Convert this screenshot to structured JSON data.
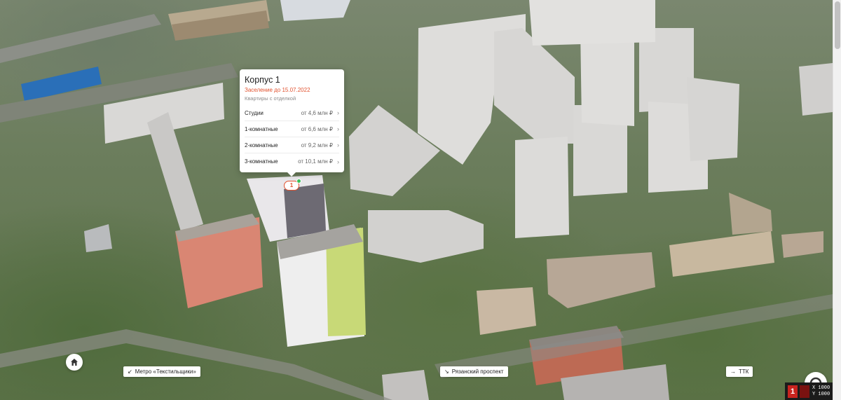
{
  "popup": {
    "title": "Корпус 1",
    "settlement": "Заселение до 15.07.2022",
    "finish": "Квартиры с отделкой",
    "rows": [
      {
        "name": "Студии",
        "price": "от 4,6 млн ₽"
      },
      {
        "name": "1-комнатные",
        "price": "от 6,6 млн ₽"
      },
      {
        "name": "2-комнатные",
        "price": "от 9,2 млн ₽"
      },
      {
        "name": "3-комнатные",
        "price": "от 10,1 млн ₽"
      }
    ],
    "chevron": "›"
  },
  "pin": {
    "label": "1"
  },
  "nav": {
    "metro": {
      "arrow": "↙",
      "label": "Метро «Текстильщики»"
    },
    "ryazan": {
      "arrow": "↘",
      "label": "Рязанский проспект"
    },
    "ttk": {
      "arrow": "→",
      "label": "ТТК"
    }
  },
  "coords": {
    "x": "X 1000",
    "y": "Y 1000",
    "icon_glyph": "1"
  },
  "colors": {
    "accent": "#e2522f",
    "pin_dot": "#3ac15b"
  },
  "icons": {
    "home": "home-icon",
    "chevron": "chevron-right-icon",
    "arrow": "arrow-icon"
  }
}
